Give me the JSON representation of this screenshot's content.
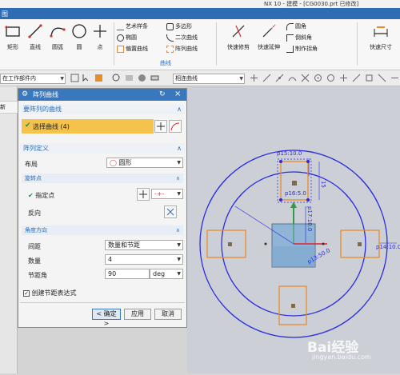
{
  "window": {
    "title": "NX 10 - 建模 - [CG0030.prt 已修改]",
    "menu_label": "图"
  },
  "ribbon": {
    "large_buttons": [
      {
        "label": "矩形"
      },
      {
        "label": "直线"
      },
      {
        "label": "圆弧"
      },
      {
        "label": "圆"
      },
      {
        "label": "点"
      }
    ],
    "curve_small": [
      {
        "label": "艺术样条"
      },
      {
        "label": "多边形"
      },
      {
        "label": "椭圆"
      },
      {
        "label": "二次曲线"
      },
      {
        "label": "偏置曲线"
      },
      {
        "label": "阵列曲线"
      }
    ],
    "curve_group_label": "曲线",
    "edit_buttons": [
      {
        "label": "快速修剪"
      },
      {
        "label": "快速延伸"
      }
    ],
    "edit_small": [
      {
        "label": "圆角"
      },
      {
        "label": "倒斜角"
      },
      {
        "label": "制作拐角"
      }
    ],
    "dim_button": {
      "label": "快速尺寸"
    }
  },
  "toolbar": {
    "filter_combo": "在工作部件内",
    "curve_rule_combo": "相连曲线"
  },
  "left_strip": {
    "label": "新"
  },
  "dialog": {
    "title": "阵列曲线",
    "section_curves": {
      "title": "要阵列的曲线",
      "select_label": "选择曲线 (4)"
    },
    "section_pattern": {
      "title": "阵列定义",
      "layout_label": "布局",
      "layout_value": "圆形",
      "rotation_point": {
        "title": "旋转点",
        "specify_point": "指定点",
        "reverse": "反向"
      },
      "angle_direction": {
        "title": "角度方向",
        "spacing_label": "间距",
        "spacing_value": "数量和节距",
        "count_label": "数量",
        "count_value": "4",
        "pitch_label": "节距角",
        "pitch_value": "90",
        "pitch_unit": "deg"
      }
    },
    "create_expr_label": "创建节距表达式",
    "create_expr_checked": true,
    "buttons": {
      "ok": "< 确定 >",
      "apply": "应用",
      "cancel": "取消"
    }
  },
  "canvas": {
    "dimension_labels": [
      "p15:10.0",
      "p16:5.0",
      "15",
      "p17:10.0",
      "p13:50.0",
      "p14:10.0"
    ],
    "watermark": "Bai经验",
    "watermark_sub": "jingyan.baidu.com"
  },
  "colors": {
    "accent": "#2e6db4",
    "selection": "#f5c24c",
    "sketch_orange": "#e88b2a",
    "circle_blue": "#2a2ae0",
    "solid_face": "#8fb4d6"
  }
}
